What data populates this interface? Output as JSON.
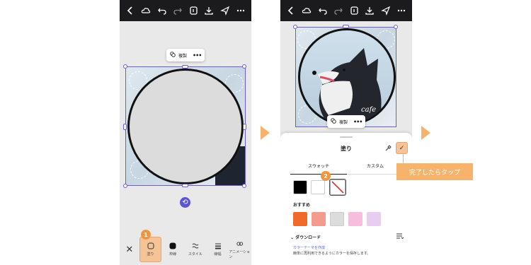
{
  "left_phone": {
    "float_menu": {
      "duplicate_label": "複製",
      "more_label": "•••"
    },
    "tools": [
      {
        "label": "塗り",
        "icon": "fill-icon"
      },
      {
        "label": "枠線",
        "icon": "stroke-icon"
      },
      {
        "label": "スタイル",
        "icon": "style-icon"
      },
      {
        "label": "線幅",
        "icon": "line-width-icon"
      },
      {
        "label": "アニメーション",
        "icon": "animation-icon"
      }
    ],
    "step_badge": "1"
  },
  "right_phone": {
    "float_menu": {
      "duplicate_label": "複製",
      "more_label": "•••"
    },
    "image_text": "cafe",
    "panel": {
      "title": "塗り",
      "tabs": [
        "スウォッチ",
        "カスタム"
      ],
      "swatches": [
        "#000000",
        "#ffffff",
        "none"
      ],
      "recommended_label": "おすすめ",
      "recommended_colors": [
        "#f06a2c",
        "#f39c8e",
        "#dcdcdc",
        "#f6bedc",
        "#e9cdf0"
      ],
      "download_label": "ダウンロード",
      "note_link": "カラーテーマを作成",
      "note_text": "簡単に再利用できるようにカラーを保存します。"
    },
    "step_badge": "2"
  },
  "callout": "完了したらタップ",
  "colors": {
    "accent": "#f1963e",
    "selection": "#6a5be0",
    "topbar": "#1b1b1d"
  }
}
